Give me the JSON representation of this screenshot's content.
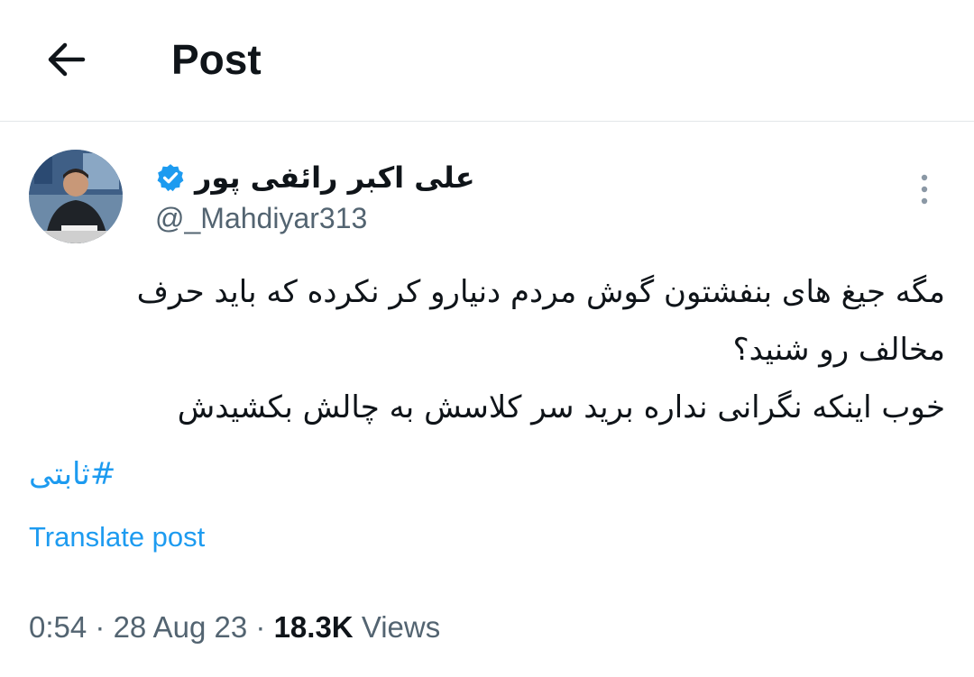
{
  "header": {
    "back_icon": "arrow-left-icon",
    "title": "Post"
  },
  "author": {
    "display_name": "علی اکبر رائفی پور",
    "verified_icon": "verified-badge-icon",
    "verified_color": "#1d9bf0",
    "handle": "@_Mahdiyar313"
  },
  "tweet": {
    "lines": [
      "مگه جیغ های بنفشتون گوش مردم دنیارو کر نکرده که باید حرف",
      "مخالف رو شنید؟",
      "خوب اینکه نگرانی نداره برید سر کلاسش به چالش بکشیدش"
    ],
    "hashtag": "#ثابتی",
    "translate_label": "Translate post"
  },
  "meta": {
    "time": "0:54",
    "separator": "·",
    "date": "28 Aug 23",
    "views_count": "18.3K",
    "views_label": "Views"
  },
  "more_icon": "more-vertical-icon",
  "colors": {
    "accent": "#1d9bf0",
    "text": "#0f1419",
    "secondary": "#536471"
  }
}
